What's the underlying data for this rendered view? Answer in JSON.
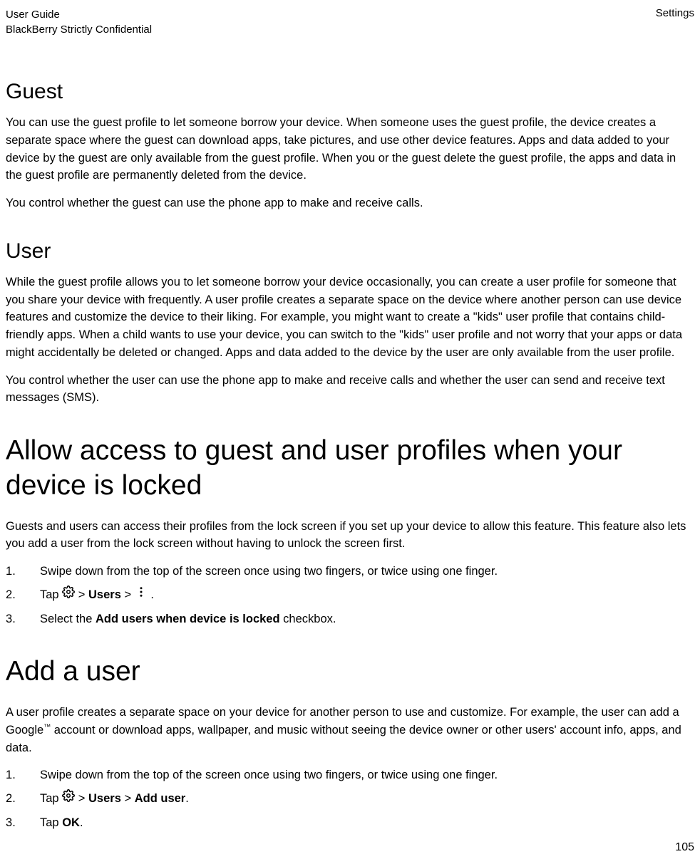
{
  "header": {
    "line1": "User Guide",
    "line2": "BlackBerry Strictly Confidential",
    "right": "Settings"
  },
  "guest": {
    "heading": "Guest",
    "p1": "You can use the guest profile to let someone borrow your device. When someone uses the guest profile, the device creates a separate space where the guest can download apps, take pictures, and use other device features. Apps and data added to your device by the guest are only available from the guest profile. When you or the guest delete the guest profile, the apps and data in the guest profile are permanently deleted from the device.",
    "p2": "You control whether the guest can use the phone app to make and receive calls."
  },
  "user": {
    "heading": "User",
    "p1": "While the guest profile allows you to let someone borrow your device occasionally, you can create a user profile for someone that you share your device with frequently. A user profile creates a separate space on the device where another person can use device features and customize the device to their liking. For example, you might want to create a \"kids\" user profile that contains child-friendly apps. When a child wants to use your device, you can switch to the \"kids\" user profile and not worry that your apps or data might accidentally be deleted or changed. Apps and data added to the device by the user are only available from the user profile.",
    "p2": "You control whether the user can use the phone app to make and receive calls and whether the user can send and receive text messages (SMS)."
  },
  "allow": {
    "heading": "Allow access to guest and user profiles when your device is locked",
    "p1": "Guests and users can access their profiles from the lock screen if you set up your device to allow this feature. This feature also lets you add a user from the lock screen without having to unlock the screen first.",
    "step1": "Swipe down from the top of the screen once using two fingers, or twice using one finger.",
    "step2_a": "Tap ",
    "step2_b": " > ",
    "step2_users": "Users",
    "step2_c": " > ",
    "step2_d": ".",
    "step3_a": "Select the ",
    "step3_bold": "Add users when device is locked",
    "step3_b": " checkbox."
  },
  "adduser": {
    "heading": "Add a user",
    "p1_a": "A user profile creates a separate space on your device for another person to use and customize. For example, the user can add a Google",
    "p1_tm": "™",
    "p1_b": " account or download apps, wallpaper, and music without seeing the device owner or other users' account info, apps, and data.",
    "step1": "Swipe down from the top of the screen once using two fingers, or twice using one finger.",
    "step2_a": "Tap ",
    "step2_b": " > ",
    "step2_users": "Users",
    "step2_c": " > ",
    "step2_adduser": "Add user",
    "step2_d": ".",
    "step3_a": "Tap ",
    "step3_ok": "OK",
    "step3_b": "."
  },
  "pageNumber": "105"
}
